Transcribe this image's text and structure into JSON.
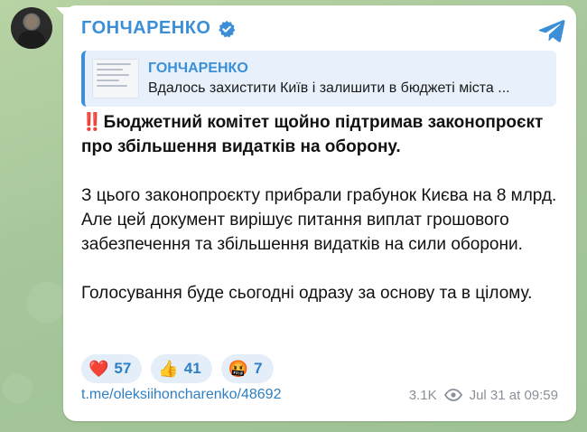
{
  "channel": {
    "name": "ГОНЧАРЕНКО",
    "accent_color": "#3a8fd6",
    "verified_icon": "verified-badge-icon",
    "share_icon": "telegram-plane-icon"
  },
  "reply": {
    "title": "ГОНЧАРЕНКО",
    "text": "Вдалось захистити Київ і залишити в бюджеті міста ..."
  },
  "message": {
    "headline_emoji": "‼️",
    "headline": "Бюджетний комітет щойно підтримав законопроєкт про збільшення видатків на оборону.",
    "paragraph1": "З цього законопроєкту прибрали грабунок Києва на 8 млрд. Але цей документ вирішує питання виплат грошового забезпечення та збільшення видатків на сили оборони.",
    "paragraph2": "Голосування буде сьогодні одразу за основу та в цілому."
  },
  "reactions": [
    {
      "emoji": "❤️",
      "icon": "heart-icon",
      "count": "57"
    },
    {
      "emoji": "👍",
      "icon": "thumbs-up-icon",
      "count": "41"
    },
    {
      "emoji": "🤬",
      "icon": "angry-face-icon",
      "count": "7"
    }
  ],
  "footer": {
    "link": "t.me/oleksiihoncharenko/48692",
    "views": "3.1K",
    "timestamp": "Jul 31 at 09:59"
  }
}
